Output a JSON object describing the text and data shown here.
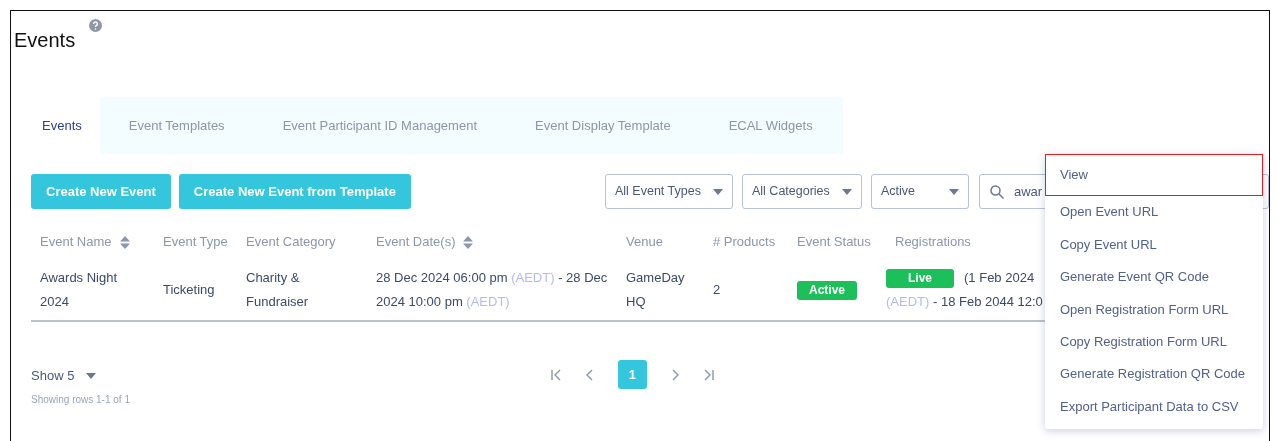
{
  "page": {
    "title": "Events"
  },
  "tabs": [
    {
      "label": "Events",
      "selected": true
    },
    {
      "label": "Event Templates",
      "selected": false
    },
    {
      "label": "Event Participant ID Management",
      "selected": false
    },
    {
      "label": "Event Display Template",
      "selected": false
    },
    {
      "label": "ECAL Widgets",
      "selected": false
    }
  ],
  "actions": [
    "Create New Event",
    "Create New Event from Template"
  ],
  "filters": [
    {
      "value": "All Event Types"
    },
    {
      "value": "All Categories"
    },
    {
      "value": "Active"
    }
  ],
  "search": {
    "value": "awar"
  },
  "table": {
    "columns": [
      {
        "label": "Event Name",
        "sortable": true
      },
      {
        "label": "Event Type",
        "sortable": false
      },
      {
        "label": "Event Category",
        "sortable": false
      },
      {
        "label": "Event Date(s)",
        "sortable": true
      },
      {
        "label": "Venue",
        "sortable": false
      },
      {
        "label": "# Products",
        "sortable": false
      },
      {
        "label": "Event Status",
        "sortable": false
      },
      {
        "label": "Registrations",
        "sortable": false
      }
    ],
    "rows": [
      {
        "name": "Awards Night 2024",
        "type": "Ticketing",
        "category": "Charity & Fundraiser",
        "dates": [
          {
            "kind": "time",
            "text": "28 Dec 2024 06:00 pm"
          },
          {
            "kind": "zone",
            "text": "(AEDT)"
          },
          {
            "kind": "time",
            "text": "- 28 Dec 2024 10:00 pm"
          },
          {
            "kind": "zone",
            "text": "(AEDT)"
          }
        ],
        "venue": "GameDay HQ",
        "products": "2",
        "status": "Active",
        "registration": {
          "badge": "Live",
          "parts": [
            {
              "kind": "time",
              "text": "(1 Feb 2024"
            },
            {
              "kind": "zone",
              "text": "(AEDT)"
            },
            {
              "kind": "time",
              "text": "- 18 Feb 2044 12:0"
            }
          ]
        }
      }
    ]
  },
  "footer": {
    "page_size": "Show 5",
    "summary": "Showing rows 1-1 of 1"
  },
  "pagination": {
    "pages": [
      {
        "label": "1",
        "selected": true
      }
    ]
  },
  "menu": {
    "items": [
      {
        "label": "View",
        "selected": true
      },
      {
        "label": "Open Event URL",
        "selected": false
      },
      {
        "label": "Copy Event URL",
        "selected": false
      },
      {
        "label": "Generate Event QR Code",
        "selected": false
      },
      {
        "label": "Open Registration Form URL",
        "selected": false
      },
      {
        "label": "Copy Registration Form URL",
        "selected": false
      },
      {
        "label": "Generate Registration QR Code",
        "selected": false
      },
      {
        "label": "Export Participant Data to CSV",
        "selected": false
      }
    ]
  }
}
